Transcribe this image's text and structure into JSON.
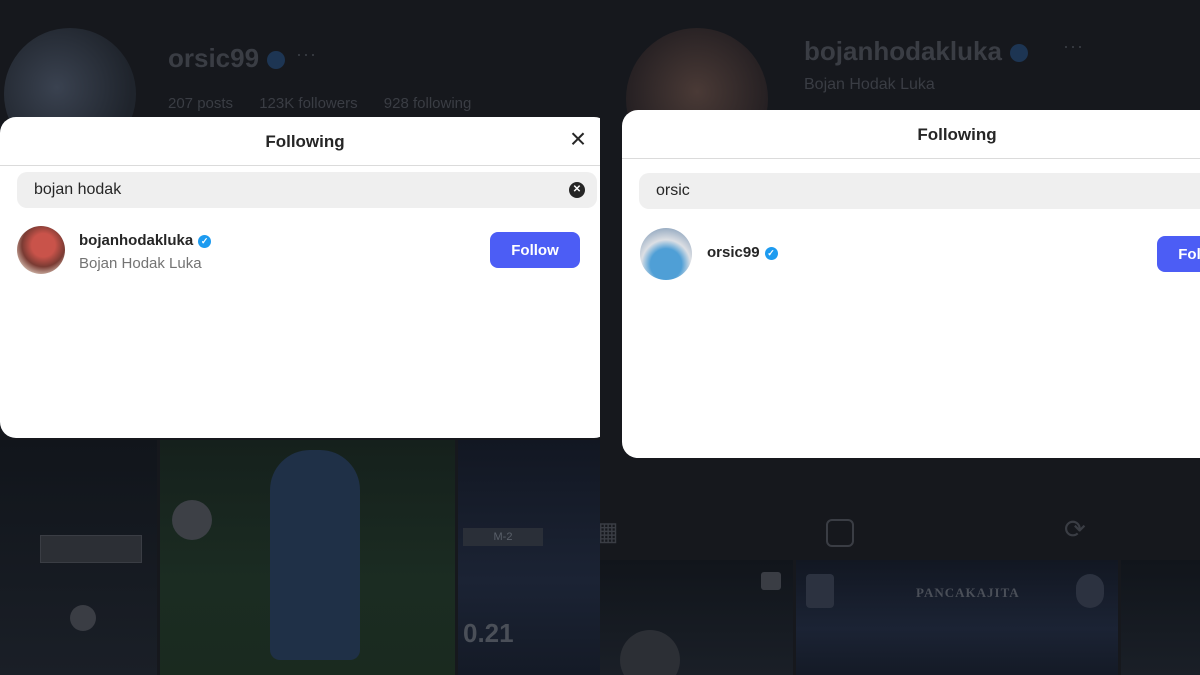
{
  "left": {
    "profile": {
      "username": "orsic99",
      "more": "···",
      "stats": [
        "207 posts",
        "123K followers",
        "928 following"
      ]
    },
    "grid": {
      "score": "0.21",
      "mini": "M-2"
    },
    "modal": {
      "title": "Following",
      "search_value": "bojan hodak",
      "clear_icon": "✕",
      "result": {
        "username": "bojanhodakluka",
        "full_name": "Bojan Hodak Luka",
        "follow_label": "Follow"
      }
    }
  },
  "right": {
    "profile": {
      "username": "bojanhodakluka",
      "more": "···",
      "full_name": "Bojan Hodak Luka"
    },
    "grid": {
      "caption": "PANCAKAJITA"
    },
    "modal": {
      "title": "Following",
      "search_value": "orsic",
      "result": {
        "username": "orsic99",
        "follow_label": "Follow"
      }
    }
  },
  "icons": {
    "verified": "✓",
    "close": "×"
  },
  "colors": {
    "follow": "#4c5df5",
    "verified": "#1d9bf0"
  }
}
